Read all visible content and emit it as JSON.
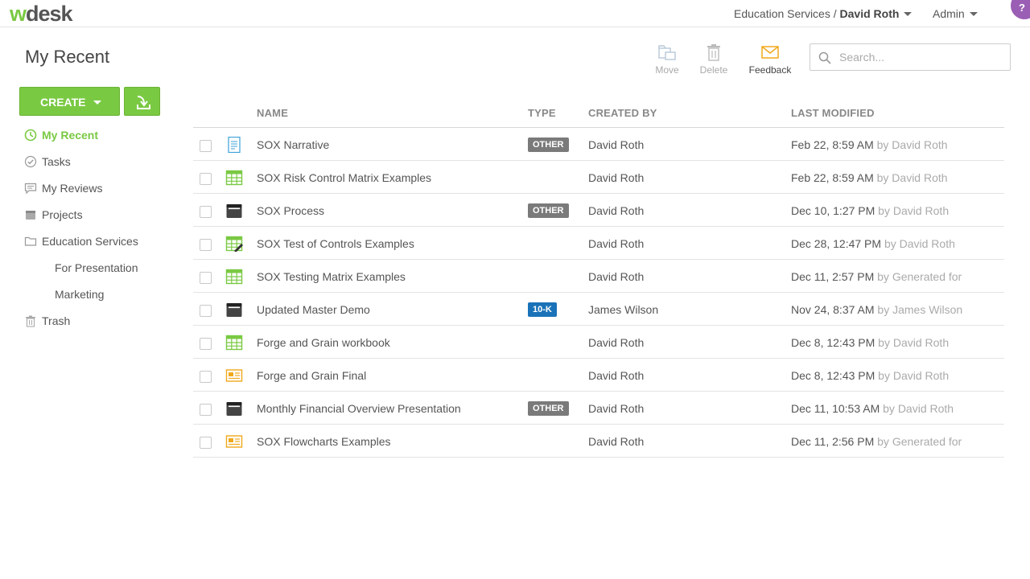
{
  "app": {
    "logo_w": "w",
    "logo_rest": "desk"
  },
  "header": {
    "org": "Education Services",
    "separator": " / ",
    "user": "David Roth",
    "admin": "Admin",
    "help": "?"
  },
  "page": {
    "title": "My Recent"
  },
  "toolbar": {
    "move": "Move",
    "delete": "Delete",
    "feedback": "Feedback",
    "search_placeholder": "Search..."
  },
  "create": {
    "label": "CREATE"
  },
  "sidebar": {
    "items": [
      {
        "label": "My Recent",
        "icon": "clock-icon",
        "active": true
      },
      {
        "label": "Tasks",
        "icon": "check-circle-icon"
      },
      {
        "label": "My Reviews",
        "icon": "comment-icon"
      },
      {
        "label": "Projects",
        "icon": "archive-box-icon"
      },
      {
        "label": "Education Services",
        "icon": "folder-icon"
      },
      {
        "label": "For Presentation",
        "sub": true
      },
      {
        "label": "Marketing",
        "sub": true
      },
      {
        "label": "Trash",
        "icon": "trash-icon"
      }
    ]
  },
  "table": {
    "columns": {
      "name": "NAME",
      "type": "TYPE",
      "created_by": "CREATED BY",
      "last_modified": "LAST MODIFIED"
    },
    "rows": [
      {
        "icon": "document-icon",
        "name": "SOX Narrative",
        "type": "OTHER",
        "created_by": "David Roth",
        "date": "Feb 22, 8:59 AM",
        "by": "by David Roth"
      },
      {
        "icon": "spreadsheet-icon",
        "name": "SOX Risk Control Matrix Examples",
        "type": "",
        "created_by": "David Roth",
        "date": "Feb 22, 8:59 AM",
        "by": "by David Roth"
      },
      {
        "icon": "binder-icon",
        "name": "SOX Process",
        "type": "OTHER",
        "created_by": "David Roth",
        "date": "Dec 10, 1:27 PM",
        "by": "by David Roth"
      },
      {
        "icon": "spreadsheet-edit-icon",
        "name": "SOX Test of Controls Examples",
        "type": "",
        "created_by": "David Roth",
        "date": "Dec 28, 12:47 PM",
        "by": "by David Roth"
      },
      {
        "icon": "spreadsheet-icon",
        "name": "SOX Testing Matrix Examples",
        "type": "",
        "created_by": "David Roth",
        "date": "Dec 11, 2:57 PM",
        "by": "by Generated for"
      },
      {
        "icon": "binder-icon",
        "name": "Updated Master Demo",
        "type": "10-K",
        "created_by": "James Wilson",
        "date": "Nov 24, 8:37 AM",
        "by": "by James Wilson"
      },
      {
        "icon": "spreadsheet-icon",
        "name": "Forge and Grain workbook",
        "type": "",
        "created_by": "David Roth",
        "date": "Dec 8, 12:43 PM",
        "by": "by David Roth"
      },
      {
        "icon": "presentation-icon",
        "name": "Forge and Grain Final",
        "type": "",
        "created_by": "David Roth",
        "date": "Dec 8, 12:43 PM",
        "by": "by David Roth"
      },
      {
        "icon": "binder-icon",
        "name": "Monthly Financial Overview Presentation",
        "type": "OTHER",
        "created_by": "David Roth",
        "date": "Dec 11, 10:53 AM",
        "by": "by David Roth"
      },
      {
        "icon": "presentation-icon",
        "name": "SOX Flowcharts Examples",
        "type": "",
        "created_by": "David Roth",
        "date": "Dec 11, 2:56 PM",
        "by": "by Generated for"
      }
    ]
  },
  "colors": {
    "accent": "#7ac943",
    "badge_gray": "#7a7a7a",
    "badge_blue": "#1a73b8",
    "help": "#9a5fb4"
  }
}
